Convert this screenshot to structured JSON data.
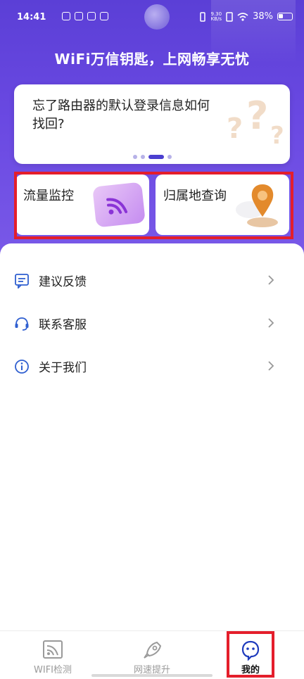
{
  "status_bar": {
    "time": "14:41",
    "net_speed_value": "9.30",
    "net_speed_unit": "KB/s",
    "battery": "38%"
  },
  "hero": {
    "headline": "WiFi万信钥匙，上网畅享无忧"
  },
  "banner": {
    "text": "忘了路由器的默认登录信息如何找回?",
    "page_index": 3,
    "page_count": 4
  },
  "cards": [
    {
      "label": "流量监控",
      "icon": "wifi-bubble-icon"
    },
    {
      "label": "归属地查询",
      "icon": "location-pin-icon"
    }
  ],
  "menu": [
    {
      "label": "建议反馈",
      "icon": "feedback-icon"
    },
    {
      "label": "联系客服",
      "icon": "headset-icon"
    },
    {
      "label": "关于我们",
      "icon": "info-icon"
    }
  ],
  "tabs": [
    {
      "label": "WIFI检测",
      "icon": "wifi-check-icon",
      "active": false
    },
    {
      "label": "网速提升",
      "icon": "rocket-icon",
      "active": false
    },
    {
      "label": "我的",
      "icon": "profile-icon",
      "active": true
    }
  ],
  "colors": {
    "hero_gradient_top": "#5b3fd6",
    "hero_gradient_bottom": "#7a5ae8",
    "accent": "#4b3fd0",
    "highlight": "#e41e2b"
  }
}
